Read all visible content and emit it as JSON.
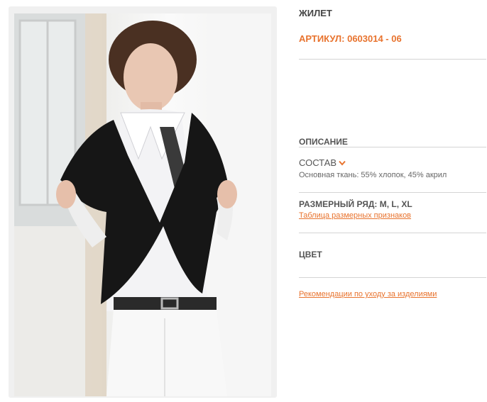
{
  "product": {
    "title": "ЖИЛЕТ",
    "article": "АРТИКУЛ: 0603014 - 06"
  },
  "description": {
    "heading": "ОПИСАНИЕ",
    "composition_label": "СОСТАВ",
    "composition_text": "Основная ткань: 55% хлопок, 45% акрил",
    "size_range": "РАЗМЕРНЫЙ РЯД: M, L, XL",
    "size_table_link": "Таблица размерных признаков",
    "color_heading": "ЦВЕТ",
    "care_link": "Рекомендации по уходу за изделиями"
  },
  "colors": {
    "accent": "#e8732e",
    "text": "#555555",
    "divider": "#d4d4d4"
  }
}
